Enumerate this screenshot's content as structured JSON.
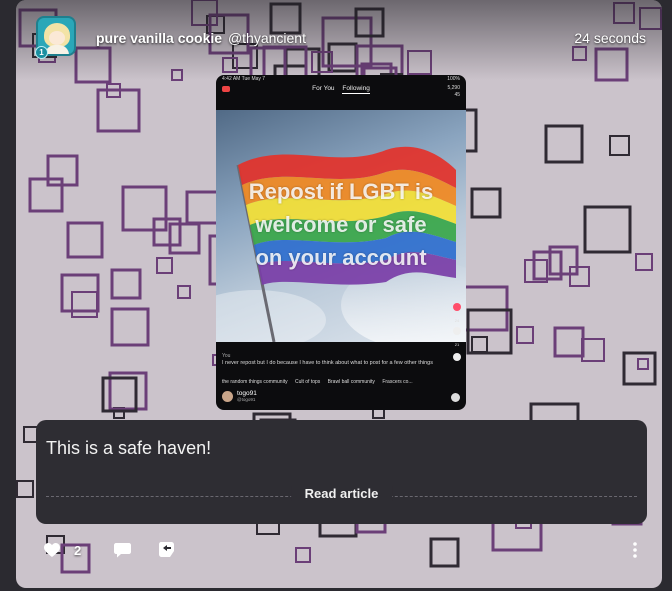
{
  "post": {
    "author_name": "pure vanilla cookie",
    "author_handle": "@thyancient",
    "timestamp": "24 seconds",
    "badge": "1"
  },
  "screenshot": {
    "status_time": "4:42 AM  Tue May 7",
    "status_right": "100%",
    "tab_for_you": "For You",
    "tab_following": "Following",
    "top_right_top": "5,290",
    "top_right_bottom": "45",
    "caption_line1": "Repost if LGBT is",
    "caption_line2": "welcome or safe",
    "caption_line3": "on your account",
    "side_count1": "24",
    "side_count2": "21",
    "desc_label": "You",
    "description": "I never repost but I do because I have to think about what to post for a few other things",
    "chips": [
      "the random things community",
      "Cult of tops",
      "Brawl ball community",
      "Frascers co..."
    ],
    "username": "togo91",
    "username_sub": "@togo91"
  },
  "article": {
    "title": "This is a safe haven!",
    "read_label": "Read article"
  },
  "actions": {
    "like_count": "2"
  },
  "colors": {
    "background": "#cbc3cb",
    "square_border": "#6b3f78",
    "overlay": "#2e2d33"
  }
}
